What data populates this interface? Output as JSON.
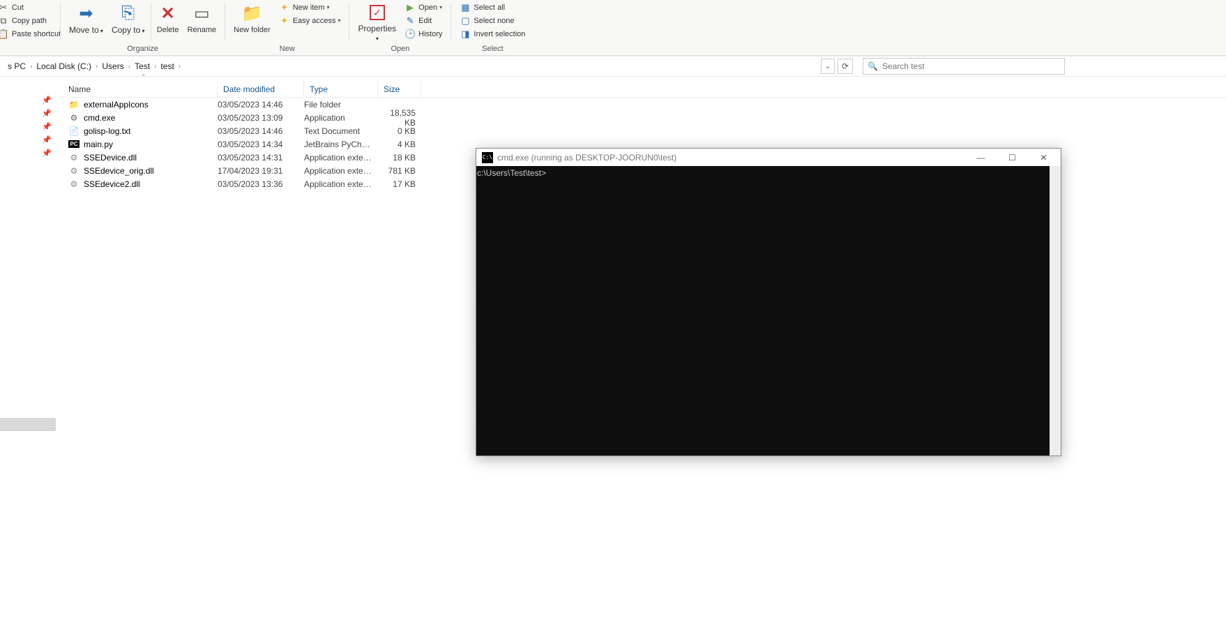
{
  "ribbon": {
    "clipboard": {
      "cut": "Cut",
      "copy_path": "Copy path",
      "paste_shortcut": "Paste shortcut"
    },
    "organize": {
      "label": "Organize",
      "move_to": "Move to",
      "copy_to": "Copy to",
      "delete": "Delete",
      "rename": "Rename"
    },
    "new": {
      "label": "New",
      "new_folder": "New folder",
      "new_item": "New item",
      "easy_access": "Easy access"
    },
    "open": {
      "label": "Open",
      "properties": "Properties",
      "open": "Open",
      "edit": "Edit",
      "history": "History"
    },
    "select": {
      "label": "Select",
      "select_all": "Select all",
      "select_none": "Select none",
      "invert": "Invert selection"
    }
  },
  "breadcrumb": [
    "s PC",
    "Local Disk (C:)",
    "Users",
    "Test",
    "test"
  ],
  "search": {
    "placeholder": "Search test"
  },
  "columns": {
    "name": "Name",
    "date": "Date modified",
    "type": "Type",
    "size": "Size"
  },
  "files": [
    {
      "icon": "folder",
      "name": "externalAppIcons",
      "date": "03/05/2023 14:46",
      "type": "File folder",
      "size": ""
    },
    {
      "icon": "gear",
      "name": "cmd.exe",
      "date": "03/05/2023 13:09",
      "type": "Application",
      "size": "18,535 KB"
    },
    {
      "icon": "txt",
      "name": "golisp-log.txt",
      "date": "03/05/2023 14:46",
      "type": "Text Document",
      "size": "0 KB"
    },
    {
      "icon": "pc",
      "name": "main.py",
      "date": "03/05/2023 14:34",
      "type": "JetBrains PyChar...",
      "size": "4 KB"
    },
    {
      "icon": "dll",
      "name": "SSEDevice.dll",
      "date": "03/05/2023 14:31",
      "type": "Application exten...",
      "size": "18 KB"
    },
    {
      "icon": "dll",
      "name": "SSEdevice_orig.dll",
      "date": "17/04/2023 19:31",
      "type": "Application exten...",
      "size": "781 KB"
    },
    {
      "icon": "dll",
      "name": "SSEdevice2.dll",
      "date": "03/05/2023 13:36",
      "type": "Application exten...",
      "size": "17 KB"
    }
  ],
  "cmd": {
    "title": "cmd.exe (running as DESKTOP-JOORUN0\\test)",
    "icon_text": "C:\\",
    "prompt": "c:\\Users\\Test\\test>"
  }
}
